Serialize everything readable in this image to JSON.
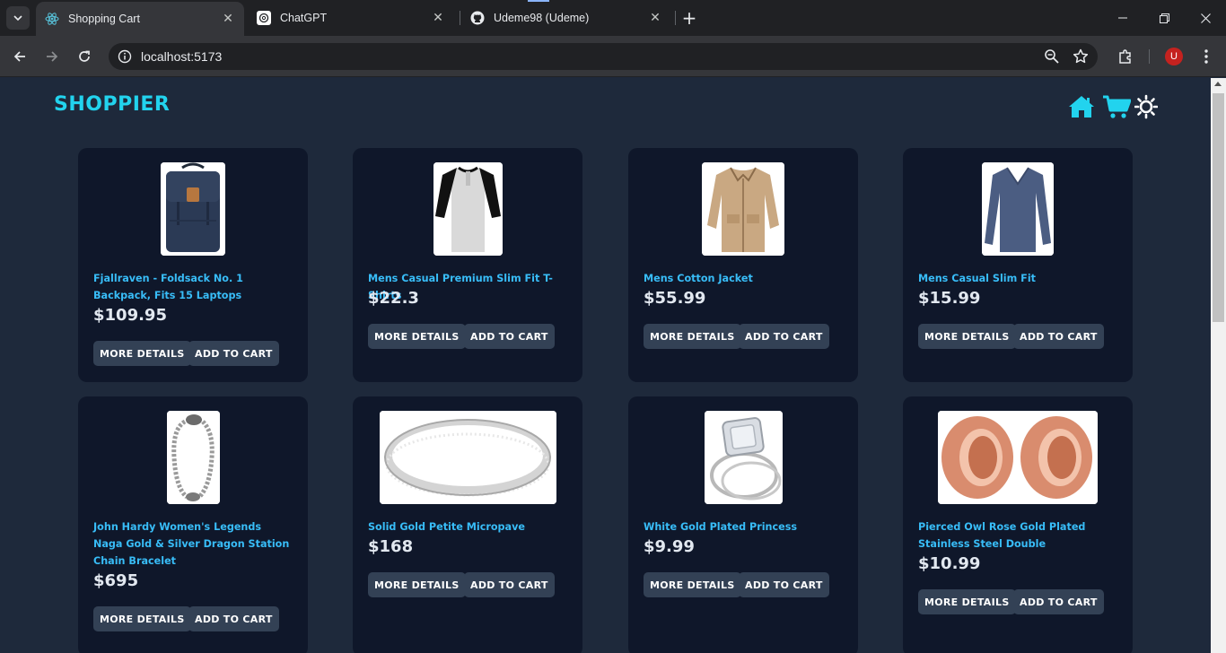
{
  "browser": {
    "tabs": [
      {
        "title": "Shopping Cart",
        "active": true,
        "icon": "react-icon"
      },
      {
        "title": "ChatGPT",
        "active": false,
        "icon": "chatgpt-icon"
      },
      {
        "title": "Udeme98 (Udeme)",
        "active": false,
        "icon": "github-icon"
      }
    ],
    "new_tab": "+",
    "url": "localhost:5173",
    "profile_initial": "U"
  },
  "header": {
    "brand": "SHOPPIER",
    "icons": [
      "home-icon",
      "cart-icon",
      "theme-toggle-sun-icon"
    ],
    "accent": "#22d3ee"
  },
  "colors": {
    "page_bg": "#1e293b",
    "card_bg": "#0f172a",
    "product_name": "#38bdf8",
    "price": "#e2e8f0",
    "button_bg": "#334155"
  },
  "products": [
    {
      "name": "Fjallraven - Foldsack No. 1 Backpack, Fits 15 Laptops",
      "price": "$109.95",
      "more": "MORE DETAILS",
      "add": "ADD TO CART",
      "image": "backpack"
    },
    {
      "name": "Mens Casual Premium Slim Fit T-Shirts",
      "price": "$22.3",
      "more": "MORE DETAILS",
      "add": "ADD TO CART",
      "image": "raglan-tshirt"
    },
    {
      "name": "Mens Cotton Jacket",
      "price": "$55.99",
      "more": "MORE DETAILS",
      "add": "ADD TO CART",
      "image": "cotton-jacket"
    },
    {
      "name": "Mens Casual Slim Fit",
      "price": "$15.99",
      "more": "MORE DETAILS",
      "add": "ADD TO CART",
      "image": "longsleeve-shirt"
    },
    {
      "name": "John Hardy Women's Legends Naga Gold & Silver Dragon Station Chain Bracelet",
      "price": "$695",
      "more": "MORE DETAILS",
      "add": "ADD TO CART",
      "image": "chain-bracelet"
    },
    {
      "name": "Solid Gold Petite Micropave",
      "price": "$168",
      "more": "MORE DETAILS",
      "add": "ADD TO CART",
      "image": "micropave-ring"
    },
    {
      "name": "White Gold Plated Princess",
      "price": "$9.99",
      "more": "MORE DETAILS",
      "add": "ADD TO CART",
      "image": "princess-ring"
    },
    {
      "name": "Pierced Owl Rose Gold Plated Stainless Steel Double",
      "price": "$10.99",
      "more": "MORE DETAILS",
      "add": "ADD TO CART",
      "image": "rose-gold-tunnels"
    }
  ]
}
